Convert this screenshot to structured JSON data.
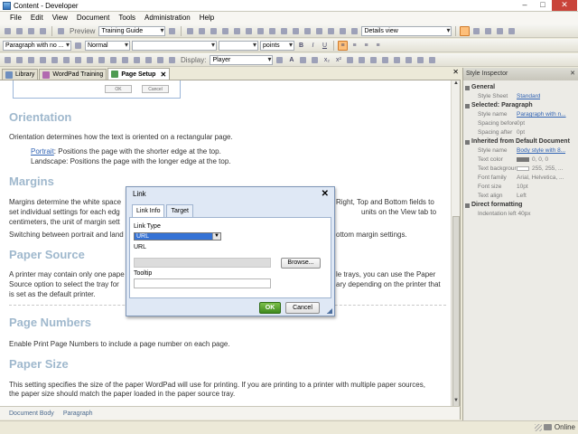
{
  "window": {
    "title": "Content - Developer"
  },
  "menu": [
    "File",
    "Edit",
    "View",
    "Document",
    "Tools",
    "Administration",
    "Help"
  ],
  "toolbar": {
    "preview_label": "Preview",
    "guide_combo": "Training Guide",
    "view_combo": "Details view",
    "paragraph_combo": "Paragraph with no ...",
    "style_combo": "Normal",
    "font_combo": "",
    "size_combo": "",
    "unit_combo": "points",
    "display_label": "Display:",
    "display_combo": "Player"
  },
  "tabs": [
    {
      "label": "Library",
      "active": false
    },
    {
      "label": "WordPad Training",
      "active": false
    },
    {
      "label": "Page Setup",
      "active": true
    }
  ],
  "mini_dialog": {
    "ok": "OK",
    "cancel": "Cancel"
  },
  "document": {
    "orientation_heading": "Orientation",
    "orientation_text": "Orientation determines how the text is oriented on a rectangular page.",
    "portrait_link": "Portrait",
    "portrait_text": ": Positions the page with the shorter edge at the top.",
    "landscape_text": "Landscape: Positions the page with the longer edge at the top.",
    "margins_heading": "Margins",
    "margins_text_1a": "Margins determine the white space",
    "margins_text_1b": "Right, Top and Bottom fields to",
    "margins_text_2a": "set individual settings for each edg",
    "margins_text_2b": "units on the View tab to",
    "margins_text_3a": "centimeters, the unit of margin sett",
    "switching_a": "Switching between portrait and land",
    "switching_b": "ottom margin settings.",
    "paper_source_heading": "Paper Source",
    "ps_1a": "A printer may contain only one pape",
    "ps_1b": "le trays, you can use the Paper",
    "ps_2a": "Source option to select the tray for",
    "ps_2b": "ary depending on the printer that",
    "ps_3a": "is set as the default printer.",
    "page_numbers_heading": "Page Numbers",
    "page_numbers_text": "Enable Print Page Numbers to include a page number on each page.",
    "paper_size_heading": "Paper Size",
    "paper_size_text_1": "This setting specifies the size of the paper WordPad will use for printing. If you are printing to a printer with multiple paper sources,",
    "paper_size_text_2": "the paper size should match the paper loaded in the paper source tray."
  },
  "doc_status": [
    "Document Body",
    "Paragraph"
  ],
  "inspector": {
    "title": "Style Inspector",
    "general": "General",
    "style_sheet_k": "Style Sheet",
    "style_sheet_v": "Standard",
    "selected": "Selected: Paragraph",
    "style_name_k": "Style name",
    "style_name_v": "Paragraph with n...",
    "spacing_before_k": "Spacing before",
    "spacing_before_v": "0pt",
    "spacing_after_k": "Spacing after",
    "spacing_after_v": "0pt",
    "inherited": "Inherited from Default Document",
    "style_name2_v": "Body style with 8...",
    "text_color_k": "Text color",
    "text_color_v": "0, 0, 0",
    "text_bg_k": "Text backgrour",
    "text_bg_v": "255, 255, ...",
    "font_family_k": "Font family",
    "font_family_v": "Arial, Helvetica, ...",
    "font_size_k": "Font size",
    "font_size_v": "10pt",
    "text_align_k": "Text align",
    "text_align_v": "Left",
    "direct": "Direct formatting",
    "indent_v": "Indentation left 40px"
  },
  "status": {
    "online": "Online"
  },
  "link_dialog": {
    "title": "Link",
    "tab_link_info": "Link Info",
    "tab_target": "Target",
    "link_type_label": "Link Type",
    "link_type_value": "URL",
    "url_label": "URL",
    "url_value": "",
    "browse": "Browse...",
    "tooltip_label": "Tooltip",
    "tooltip_value": "",
    "ok": "OK",
    "cancel": "Cancel"
  }
}
